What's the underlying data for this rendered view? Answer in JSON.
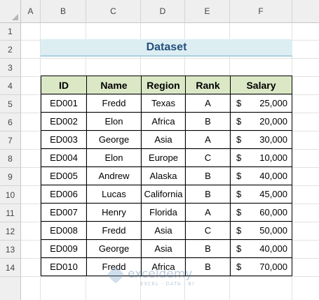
{
  "columns": [
    "A",
    "B",
    "C",
    "D",
    "E",
    "F"
  ],
  "rows": [
    "1",
    "2",
    "3",
    "4",
    "5",
    "6",
    "7",
    "8",
    "9",
    "10",
    "11",
    "12",
    "13",
    "14"
  ],
  "title": "Dataset",
  "table": {
    "headers": [
      "ID",
      "Name",
      "Region",
      "Rank",
      "Salary"
    ],
    "currency_symbol": "$",
    "rows": [
      {
        "id": "ED001",
        "name": "Fredd",
        "region": "Texas",
        "rank": "A",
        "salary": "25,000"
      },
      {
        "id": "ED002",
        "name": "Elon",
        "region": "Africa",
        "rank": "B",
        "salary": "20,000"
      },
      {
        "id": "ED003",
        "name": "George",
        "region": "Asia",
        "rank": "A",
        "salary": "30,000"
      },
      {
        "id": "ED004",
        "name": "Elon",
        "region": "Europe",
        "rank": "C",
        "salary": "10,000"
      },
      {
        "id": "ED005",
        "name": "Andrew",
        "region": "Alaska",
        "rank": "B",
        "salary": "40,000"
      },
      {
        "id": "ED006",
        "name": "Lucas",
        "region": "California",
        "rank": "B",
        "salary": "45,000"
      },
      {
        "id": "ED007",
        "name": "Henry",
        "region": "Florida",
        "rank": "A",
        "salary": "60,000"
      },
      {
        "id": "ED008",
        "name": "Fredd",
        "region": "Asia",
        "rank": "C",
        "salary": "50,000"
      },
      {
        "id": "ED009",
        "name": "George",
        "region": "Asia",
        "rank": "B",
        "salary": "40,000"
      },
      {
        "id": "ED010",
        "name": "Fredd",
        "region": "Africa",
        "rank": "B",
        "salary": "70,000"
      }
    ]
  },
  "watermark": {
    "name": "exceldemy",
    "tagline": "EXCEL · DATA · BI"
  },
  "colors": {
    "title_fill": "#ddeef3",
    "title_text": "#244f7d",
    "header_fill": "#dbe8c6",
    "header_bar": "#efefef"
  }
}
